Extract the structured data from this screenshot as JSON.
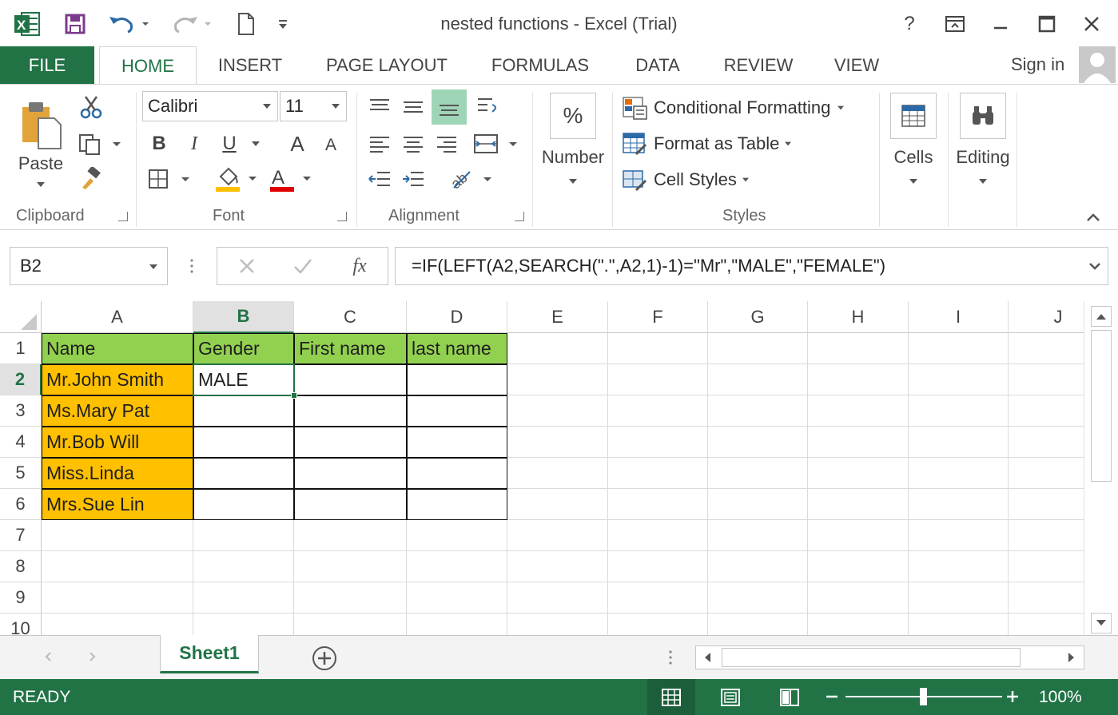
{
  "window": {
    "title": "nested functions - Excel (Trial)",
    "help": "?"
  },
  "ribbon_tabs": {
    "file": "FILE",
    "tabs": [
      "HOME",
      "INSERT",
      "PAGE LAYOUT",
      "FORMULAS",
      "DATA",
      "REVIEW",
      "VIEW"
    ],
    "active": "HOME",
    "sign_in": "Sign in"
  },
  "clipboard": {
    "paste": "Paste",
    "label": "Clipboard"
  },
  "font": {
    "family": "Calibri",
    "size": "11",
    "bold": "B",
    "italic": "I",
    "underline": "U",
    "grow": "A",
    "shrink": "A",
    "color_letter": "A",
    "label": "Font"
  },
  "alignment": {
    "label": "Alignment"
  },
  "number": {
    "symbol": "%",
    "label": "Number"
  },
  "styles": {
    "conditional": "Conditional Formatting",
    "format_table": "Format as Table",
    "cell_styles": "Cell Styles",
    "label": "Styles"
  },
  "cells": {
    "label": "Cells"
  },
  "editing": {
    "label": "Editing"
  },
  "formula_bar": {
    "name_box": "B2",
    "formula": "=IF(LEFT(A2,SEARCH(\".\",A2,1)-1)=\"Mr\",\"MALE\",\"FEMALE\")"
  },
  "sheet": {
    "columns": [
      "A",
      "B",
      "C",
      "D",
      "E",
      "F",
      "G",
      "H",
      "I",
      "J"
    ],
    "rows": [
      "1",
      "2",
      "3",
      "4",
      "5",
      "6",
      "7",
      "8",
      "9",
      "10"
    ],
    "selected_column": "B",
    "selected_row": "2",
    "cells": {
      "A1": "Name",
      "B1": "Gender",
      "C1": "First name",
      "D1": "last name",
      "A2": "Mr.John Smith",
      "B2": "MALE",
      "A3": "Ms.Mary Pat",
      "A4": "Mr.Bob Will",
      "A5": "Miss.Linda",
      "A6": "Mrs.Sue Lin"
    },
    "colors": {
      "header_fill": "#92d050",
      "name_fill": "#ffc000",
      "accent": "#217346"
    }
  },
  "sheet_tabs": {
    "tabs": [
      "Sheet1"
    ],
    "active": "Sheet1"
  },
  "status": {
    "ready": "READY",
    "zoom": "100%"
  }
}
